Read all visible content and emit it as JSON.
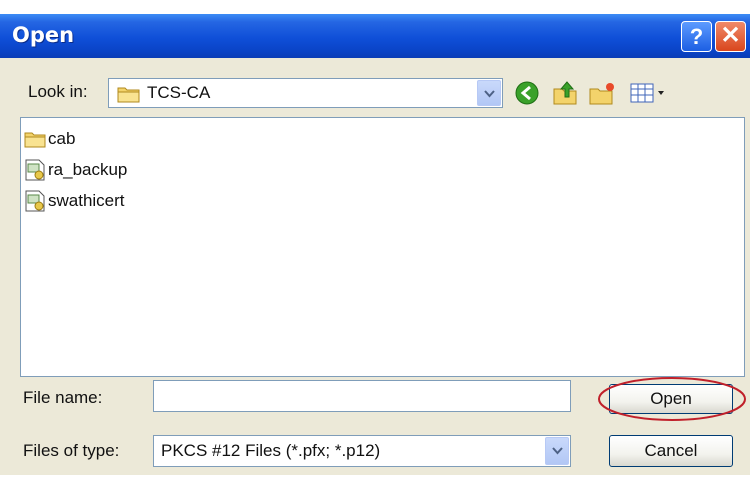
{
  "window": {
    "title": "Open"
  },
  "toolbar": {
    "look_in_label": "Look in:",
    "look_in_value": "TCS-CA"
  },
  "files": [
    {
      "name": "cab",
      "icon": "folder-icon"
    },
    {
      "name": "ra_backup",
      "icon": "certificate-file-icon"
    },
    {
      "name": "swathicert",
      "icon": "certificate-file-icon"
    }
  ],
  "form": {
    "file_name_label": "File name:",
    "file_name_value": "",
    "files_of_type_label": "Files of type:",
    "files_of_type_value": "PKCS #12 Files (*.pfx; *.p12)",
    "open_label": "Open",
    "cancel_label": "Cancel"
  },
  "colors": {
    "titlebar": "#0a43c6",
    "dialog_bg": "#ece9d8",
    "highlight_ring": "#c0202a"
  }
}
